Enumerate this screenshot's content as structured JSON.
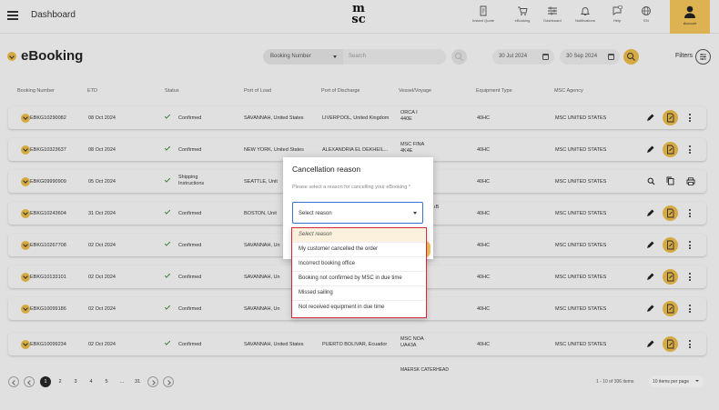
{
  "app": {
    "menu_title": "Dashboard",
    "logo_text": "msc",
    "top_icons": [
      {
        "icon": "instant-quote-icon",
        "label": "Instant Quote"
      },
      {
        "icon": "ebooking-cart-icon",
        "label": "eBooking"
      },
      {
        "icon": "dashboard-icon",
        "label": "Dashboard"
      },
      {
        "icon": "bell-icon",
        "label": "Notifications"
      },
      {
        "icon": "help-icon",
        "label": "Help"
      },
      {
        "icon": "globe-icon",
        "label": "EN"
      }
    ],
    "account_label": "Account"
  },
  "header": {
    "page_title": "eBooking",
    "search_type": "Booking Number",
    "search_placeholder": "Search",
    "date_from": "30 Jul 2024",
    "date_to": "30 Sep 2024",
    "filters_label": "Filters"
  },
  "table": {
    "columns": [
      "Booking Number",
      "ETD",
      "Status",
      "Port of Load",
      "Port of Discharge",
      "Vessel/Voyage",
      "Equipment Type",
      "MSC Agency"
    ],
    "rows": [
      {
        "booking": "EBKG10290082",
        "etd": "08 Oct 2024",
        "status": "Confirmed",
        "pol": "SAVANNAH, United States",
        "pod": "LIVERPOOL, United Kingdom",
        "vessel": "ORCA I 440E",
        "equipment": "40HC",
        "agency": "MSC UNITED STATES",
        "actions": "edit"
      },
      {
        "booking": "EBKG10323637",
        "etd": "08 Oct 2024",
        "status": "Confirmed",
        "pol": "NEW YORK, United States",
        "pod": "ALEXANDRIA EL DEKHEIL...",
        "vessel": "MSC FINA 4K4E",
        "equipment": "40HC",
        "agency": "MSC UNITED STATES",
        "actions": "edit"
      },
      {
        "booking": "EBKG09990909",
        "etd": "05 Oct 2024",
        "status": "Shipping Instructions",
        "pol": "SEATTLE, Unit",
        "pod": "",
        "vessel": "",
        "equipment": "40HC",
        "agency": "MSC UNITED STATES",
        "actions": "view"
      },
      {
        "booking": "EBKG10243604",
        "etd": "31 Oct 2024",
        "status": "Confirmed",
        "pol": "BOSTON, Unit",
        "pod": "",
        "vessel": "",
        "equipment": "40HC",
        "agency": "MSC UNITED STATES",
        "actions": "edit"
      },
      {
        "booking": "EBKG10267708",
        "etd": "02 Oct 2024",
        "status": "Confirmed",
        "pol": "SAVANNAH, Un",
        "pod": "",
        "vessel": "",
        "equipment": "40HC",
        "agency": "MSC UNITED STATES",
        "actions": "edit"
      },
      {
        "booking": "EBKG10133101",
        "etd": "02 Oct 2024",
        "status": "Confirmed",
        "pol": "SAVANNAH, Un",
        "pod": "",
        "vessel": "",
        "equipment": "40HC",
        "agency": "MSC UNITED STATES",
        "actions": "edit"
      },
      {
        "booking": "EBKG10099186",
        "etd": "02 Oct 2024",
        "status": "Confirmed",
        "pol": "SAVANNAH, Un",
        "pod": "",
        "vessel": "",
        "equipment": "40HC",
        "agency": "MSC UNITED STATES",
        "actions": "edit"
      },
      {
        "booking": "EBKG10099234",
        "etd": "02 Oct 2024",
        "status": "Confirmed",
        "pol": "SAVANNAH, United States",
        "pod": "PUERTO BOLIVAR, Ecuador",
        "vessel": "MSC NOA UA43A",
        "equipment": "40HC",
        "agency": "MSC UNITED STATES",
        "actions": "edit"
      }
    ],
    "partial_row_vessel": "MAERSK CATERHEAD"
  },
  "dialog": {
    "title": "Cancellation reason",
    "description": "Please select a reason for cancelling your eBooking *",
    "select_value": "Select reason",
    "options": [
      "Select reason",
      "My customer cancelled the order",
      "Incorrect booking office",
      "Booking not confirmed by MSC in due time",
      "Missed sailing",
      "Not received equipment in due time"
    ],
    "selected_index": 0,
    "partial_vessel_fragment": "ıB"
  },
  "pagination": {
    "pages": [
      "1",
      "2",
      "3",
      "4",
      "5",
      "...",
      "31"
    ],
    "current": "1",
    "info": "1 - 10 of 306 items",
    "per_page": "10 items per page"
  },
  "colors": {
    "accent": "#e9b949",
    "confirmed_check": "#3a8a3a",
    "dropdown_border": "#d22a3a",
    "select_border": "#3b6fd4"
  }
}
